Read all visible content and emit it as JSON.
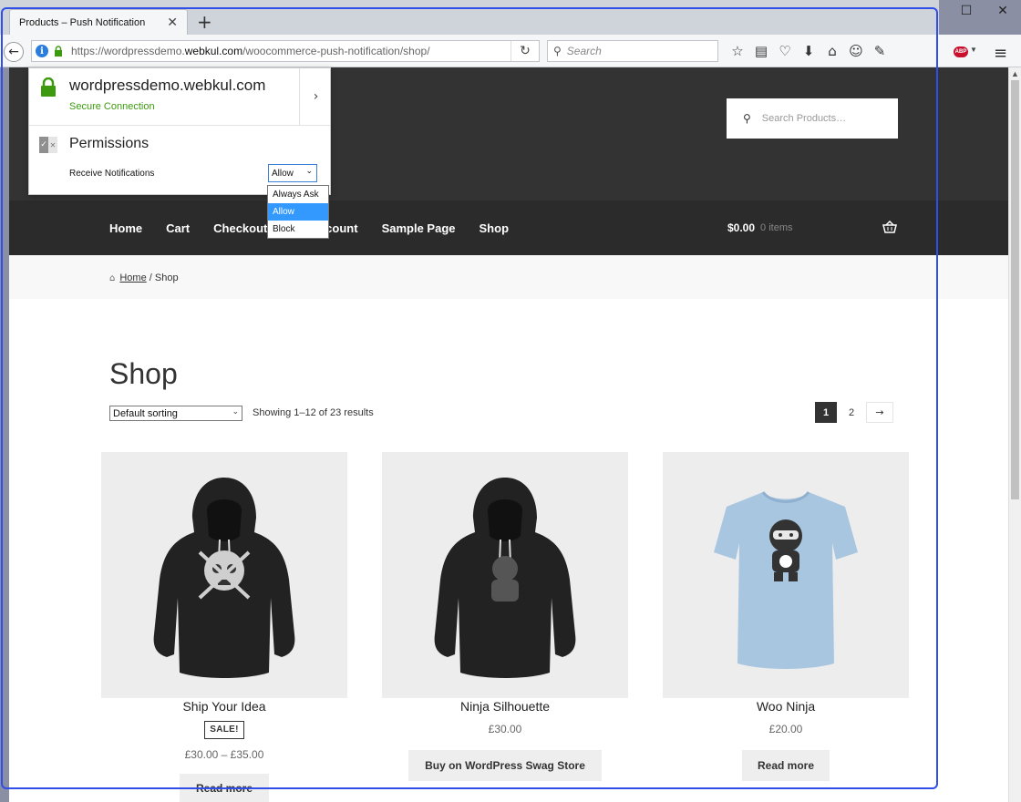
{
  "browser": {
    "tab_title": "Products – Push Notification",
    "tab_close": "✕",
    "new_tab": "+",
    "url_prefix": "https://wordpressdemo.",
    "url_domain": "webkul.com",
    "url_path": "/woocommerce-push-notification/shop/",
    "search_placeholder": "Search",
    "window_minimize": "—",
    "window_maximize": "☐",
    "window_close": "✕",
    "abp_label": "ABP"
  },
  "popup": {
    "site": "wordpressdemo.webkul.com",
    "status": "Secure Connection",
    "permissions_title": "Permissions",
    "permission_label": "Receive Notifications",
    "permission_value": "Allow",
    "options": [
      "Always Ask",
      "Allow",
      "Block"
    ],
    "selected_option": "Allow"
  },
  "site": {
    "search_placeholder": "Search Products…",
    "nav": [
      "Home",
      "Cart",
      "Checkout",
      "My Account",
      "Sample Page",
      "Shop"
    ],
    "cart_total": "$0.00",
    "cart_items": "0 items",
    "breadcrumb_home": "Home",
    "breadcrumb_sep": "/ Shop",
    "page_title": "Shop",
    "sorting": "Default sorting",
    "results": "Showing 1–12 of 23 results",
    "pages": [
      "1",
      "2"
    ],
    "next": "→"
  },
  "products": [
    {
      "name": "Ship Your Idea",
      "badge": "SALE!",
      "price": "£30.00 – £35.00",
      "button": "Read more"
    },
    {
      "name": "Ninja Silhouette",
      "price": "£30.00",
      "button": "Buy on WordPress Swag Store"
    },
    {
      "name": "Woo Ninja",
      "price": "£20.00",
      "button": "Read more"
    }
  ],
  "colors": {
    "header": "#333333",
    "nav": "#2b2b2b",
    "secure_green": "#3d9a0e",
    "focus_blue": "#2f4fe8",
    "selected": "#3399ff"
  }
}
